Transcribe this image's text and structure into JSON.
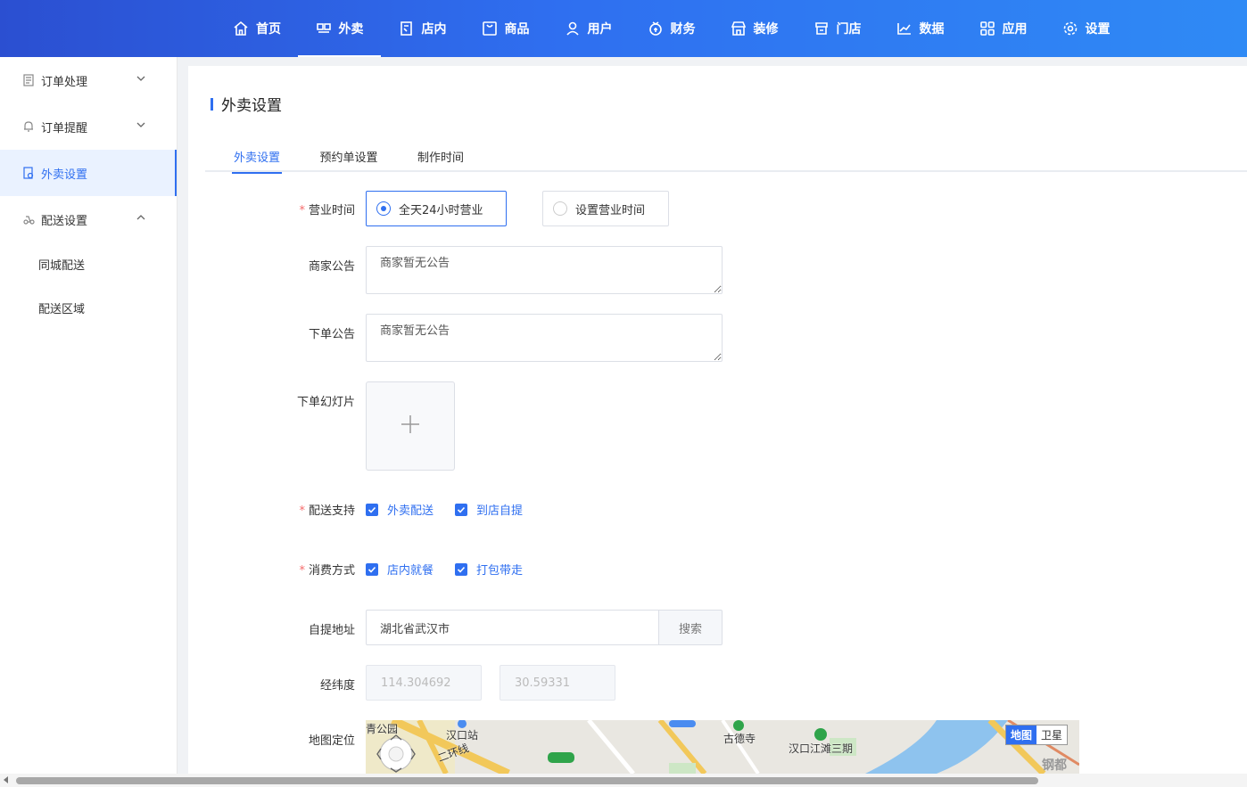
{
  "top_nav": [
    {
      "label": "首页",
      "icon": "home-icon"
    },
    {
      "label": "外卖",
      "icon": "takeout-icon",
      "active": true
    },
    {
      "label": "店内",
      "icon": "dine-in-icon"
    },
    {
      "label": "商品",
      "icon": "goods-icon"
    },
    {
      "label": "用户",
      "icon": "user-icon"
    },
    {
      "label": "财务",
      "icon": "finance-icon"
    },
    {
      "label": "装修",
      "icon": "decoration-icon"
    },
    {
      "label": "门店",
      "icon": "store-icon"
    },
    {
      "label": "数据",
      "icon": "chart-icon"
    },
    {
      "label": "应用",
      "icon": "apps-icon"
    },
    {
      "label": "设置",
      "icon": "gear-icon"
    }
  ],
  "sidebar": {
    "items": [
      {
        "label": "订单处理",
        "icon": "order-icon"
      },
      {
        "label": "订单提醒",
        "icon": "bell-icon"
      },
      {
        "label": "外卖设置",
        "icon": "settings-doc-icon",
        "active": true
      },
      {
        "label": "配送设置",
        "icon": "delivery-icon"
      }
    ],
    "sub_items": [
      "同城配送",
      "配送区域"
    ]
  },
  "page": {
    "title": "外卖设置",
    "tabs": [
      "外卖设置",
      "预约单设置",
      "制作时间"
    ]
  },
  "form": {
    "business_hours_label": "营业时间",
    "option_24h": "全天24小时营业",
    "option_custom": "设置营业时间",
    "merchant_notice_label": "商家公告",
    "merchant_notice_value": "商家暂无公告",
    "order_notice_label": "下单公告",
    "order_notice_value": "商家暂无公告",
    "slideshow_label": "下单幻灯片",
    "delivery_label": "配送支持",
    "delivery_options": [
      "外卖配送",
      "到店自提"
    ],
    "consume_label": "消费方式",
    "consume_options": [
      "店内就餐",
      "打包带走"
    ],
    "pickup_label": "自提地址",
    "pickup_value": "湖北省武汉市",
    "search_label": "搜索",
    "latlng_label": "经纬度",
    "lng_value": "114.304692",
    "lat_value": "30.59331",
    "map_label": "地图定位"
  },
  "map": {
    "labels": [
      "青公园",
      "汉口站",
      "二环线",
      "古德寺",
      "汉口江滩三期",
      "钢都"
    ],
    "toggle_map": "地图",
    "toggle_satellite": "卫星"
  },
  "colors": {
    "accent": "#2f6ff0",
    "required": "#f56c6c"
  }
}
